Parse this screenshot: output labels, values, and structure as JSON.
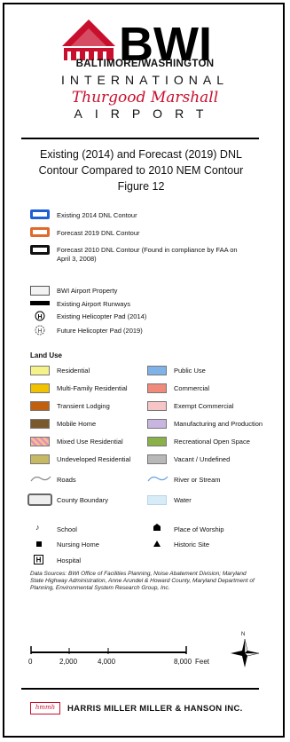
{
  "header": {
    "logo_text": "BWI",
    "airport_line1": "BALTIMORE/WASHINGTON",
    "airport_line2": "INTERNATIONAL",
    "airport_line3": "Thurgood Marshall",
    "airport_line4": "AIRPORT",
    "brand_color": "#c8102e"
  },
  "title": {
    "line1": "Existing (2014) and Forecast (2019) DNL",
    "line2": "Contour Compared to 2010 NEM Contour",
    "line3": "Figure 12"
  },
  "contours": [
    {
      "label": "Existing 2014 DNL Contour",
      "color": "#1f5fd6"
    },
    {
      "label": "Forecast 2019 DNL Contour",
      "color": "#e06a2b"
    },
    {
      "label": "Forecast 2010 DNL Contour (Found in compliance by FAA on",
      "label2": "April 3, 2008)",
      "color": "#111111"
    }
  ],
  "airport_items": [
    {
      "label": "BWI Airport Property",
      "icon": "property-box"
    },
    {
      "label": "Existing Airport Runways",
      "icon": "runway-bar"
    },
    {
      "label": "Existing Helicopter Pad (2014)",
      "icon": "helipad-symbol"
    },
    {
      "label": "Future Helicopter Pad (2019)",
      "icon": "helipad-symbol-future"
    }
  ],
  "land_use": {
    "heading": "Land Use",
    "left": [
      {
        "label": "Residential",
        "color": "#f6f28a"
      },
      {
        "label": "Multi-Family Residential",
        "color": "#f2c200"
      },
      {
        "label": "Transient Lodging",
        "color": "#c06010"
      },
      {
        "label": "Mobile Home",
        "color": "#7a5a2c"
      },
      {
        "label": "Mixed Use Residential",
        "color": "#f3c08a",
        "hatch": true
      },
      {
        "label": "Undeveloped Residential",
        "color": "#c7b862"
      }
    ],
    "right": [
      {
        "label": "Public Use",
        "color": "#7fb2e6"
      },
      {
        "label": "Commercial",
        "color": "#f08a7a"
      },
      {
        "label": "Exempt Commercial",
        "color": "#f6c6c6"
      },
      {
        "label": "Manufacturing and Production",
        "color": "#c8b6e0"
      },
      {
        "label": "Recreational Open Space",
        "color": "#8ab04a"
      },
      {
        "label": "Vacant / Undefined",
        "color": "#b8b8b8"
      }
    ]
  },
  "lines": [
    {
      "label": "Roads",
      "color": "#888888"
    },
    {
      "label": "River or Stream",
      "color": "#6aa0e0"
    }
  ],
  "areas": [
    {
      "label": "County Boundary"
    },
    {
      "label": "Water",
      "color": "#d8ecf8"
    }
  ],
  "points": [
    {
      "label": "School",
      "icon": "school-icon"
    },
    {
      "label": "Place of Worship",
      "icon": "worship-icon"
    },
    {
      "label": "Nursing Home",
      "icon": "nursing-home-icon"
    },
    {
      "label": "Historic Site",
      "icon": "historic-site-icon"
    },
    {
      "label": "Hospital",
      "icon": "hospital-icon"
    }
  ],
  "sources": "Data Sources: BWI Office of Facilities Planning, Noise Abatement Division; Maryland State Highway Administration, Anne Arundel & Howard County, Maryland Department of Planning, Environmental System Research Group, Inc.",
  "scale": {
    "labels": [
      "0",
      "2,000",
      "4,000",
      "8,000"
    ],
    "unit": "Feet",
    "north": "N"
  },
  "footer": {
    "logo_text": "hmmh",
    "company": "HARRIS MILLER MILLER & HANSON INC."
  }
}
